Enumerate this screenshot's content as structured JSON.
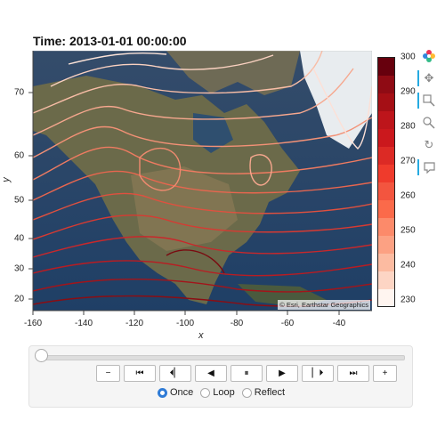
{
  "plot": {
    "title": "Time: 2013-01-01 00:00:00",
    "xlabel": "x",
    "ylabel": "y",
    "attribution": "© Esri, Earthstar Geographics"
  },
  "chart_data": {
    "type": "contour",
    "title": "Time: 2013-01-01 00:00:00",
    "xlabel": "x",
    "ylabel": "y",
    "xlim": [
      -160,
      -30
    ],
    "ylim": [
      16,
      76
    ],
    "xticks": [
      -160,
      -140,
      -120,
      -100,
      -80,
      -60,
      -40
    ],
    "yticks": [
      20,
      30,
      40,
      50,
      60,
      70
    ],
    "colorbar": {
      "min": 228,
      "max": 300,
      "ticks": [
        230,
        240,
        250,
        260,
        270,
        280,
        290,
        300
      ],
      "colormap": "Reds"
    },
    "basemap": "satellite imagery"
  },
  "xticks": [
    "-160",
    "-140",
    "-120",
    "-100",
    "-80",
    "-60",
    "-40"
  ],
  "yticks": [
    "20",
    "30",
    "40",
    "50",
    "60",
    "70"
  ],
  "colorbar_ticks": [
    "300",
    "290",
    "280",
    "270",
    "260",
    "250",
    "240",
    "230"
  ],
  "toolbar": {
    "icons": [
      "bokeh-logo-icon",
      "pan-icon",
      "box-zoom-icon",
      "wheel-zoom-icon",
      "reset-icon",
      "hover-icon"
    ]
  },
  "player": {
    "buttons": [
      "−",
      "⏮",
      "⏴▏",
      "◀",
      "⏸",
      "▶",
      "▏⏵",
      "⏭",
      "+"
    ],
    "modes": [
      "Once",
      "Loop",
      "Reflect"
    ],
    "selected_mode": "Once"
  }
}
